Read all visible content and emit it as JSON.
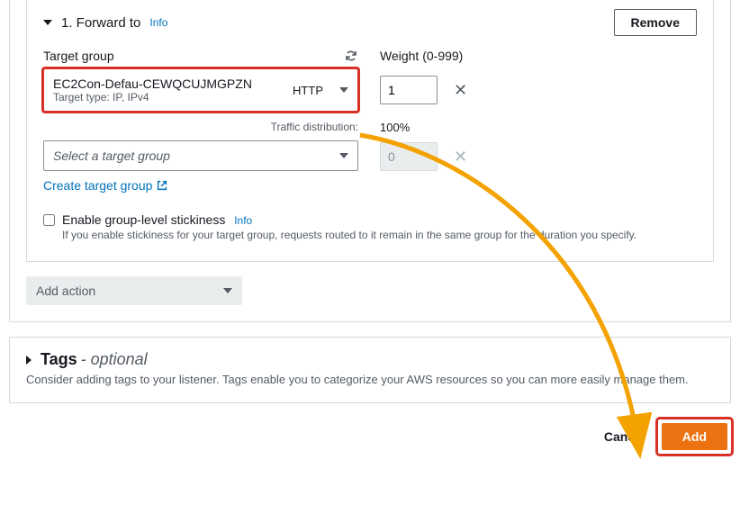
{
  "action": {
    "title": "1. Forward to",
    "info": "Info",
    "remove": "Remove"
  },
  "targetGroup": {
    "label": "Target group",
    "selected": {
      "name": "EC2Con-Defau-CEWQCUJMGPZN",
      "subtype": "Target type: IP, IPv4",
      "protocol": "HTTP"
    },
    "placeholder": "Select a target group",
    "createLink": "Create target group"
  },
  "weight": {
    "label": "Weight (0-999)",
    "value": "1",
    "placeholder2": "0"
  },
  "traffic": {
    "label": "Traffic distribution:",
    "value": "100%"
  },
  "stickiness": {
    "label": "Enable group-level stickiness",
    "info": "Info",
    "desc": "If you enable stickiness for your target group, requests routed to it remain in the same group for the duration you specify."
  },
  "addAction": {
    "label": "Add action"
  },
  "tags": {
    "title": "Tags",
    "optional": "- optional",
    "desc": "Consider adding tags to your listener. Tags enable you to categorize your AWS resources so you can more easily manage them."
  },
  "footer": {
    "cancel": "Cancel",
    "add": "Add"
  }
}
